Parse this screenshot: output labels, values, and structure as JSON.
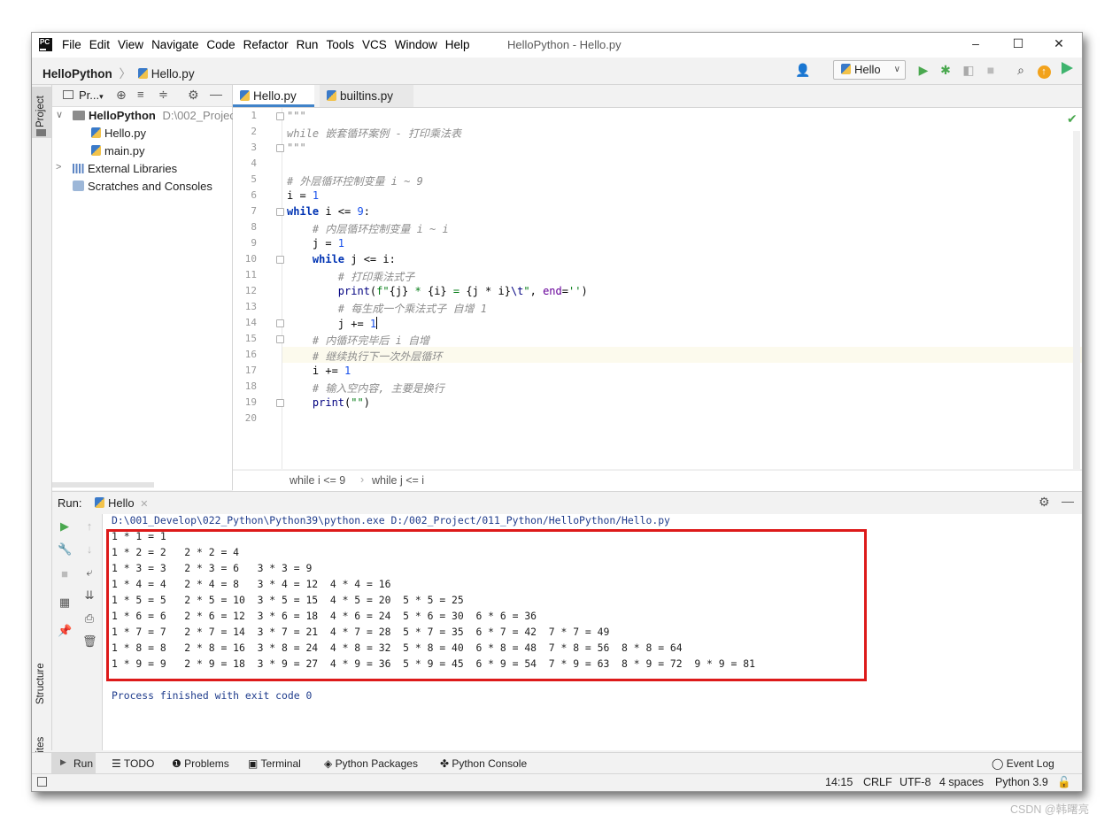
{
  "titlebar": {
    "menu": [
      "File",
      "Edit",
      "View",
      "Navigate",
      "Code",
      "Refactor",
      "Run",
      "Tools",
      "VCS",
      "Window",
      "Help"
    ],
    "title": "HelloPython - Hello.py",
    "controls": [
      "–",
      "☐",
      "✕"
    ]
  },
  "navbar": {
    "project": "HelloPython",
    "file": "Hello.py",
    "run_config": "Hello"
  },
  "left_stripe": {
    "project_tab": "Project",
    "structure_tab": "Structure",
    "favorites_tab": "Favorites"
  },
  "project_panel": {
    "header": "Pr...",
    "tree": [
      {
        "label": "HelloPython",
        "path": "D:\\002_Projec"
      },
      {
        "label": "Hello.py"
      },
      {
        "label": "main.py"
      },
      {
        "label": "External Libraries"
      },
      {
        "label": "Scratches and Consoles"
      }
    ]
  },
  "editor": {
    "tabs": [
      "Hello.py",
      "builtins.py"
    ],
    "breadcrumb": [
      "while i <= 9",
      "while j <= i"
    ],
    "current_line": 14,
    "line_count": 20
  },
  "run_panel": {
    "label": "Run:",
    "tab": "Hello",
    "command": "D:\\001_Develop\\022_Python\\Python39\\python.exe D:/002_Project/011_Python/HelloPython/Hello.py",
    "output": [
      "1 * 1 = 1",
      "1 * 2 = 2   2 * 2 = 4",
      "1 * 3 = 3   2 * 3 = 6   3 * 3 = 9",
      "1 * 4 = 4   2 * 4 = 8   3 * 4 = 12  4 * 4 = 16",
      "1 * 5 = 5   2 * 5 = 10  3 * 5 = 15  4 * 5 = 20  5 * 5 = 25",
      "1 * 6 = 6   2 * 6 = 12  3 * 6 = 18  4 * 6 = 24  5 * 6 = 30  6 * 6 = 36",
      "1 * 7 = 7   2 * 7 = 14  3 * 7 = 21  4 * 7 = 28  5 * 7 = 35  6 * 7 = 42  7 * 7 = 49",
      "1 * 8 = 8   2 * 8 = 16  3 * 8 = 24  4 * 8 = 32  5 * 8 = 40  6 * 8 = 48  7 * 8 = 56  8 * 8 = 64",
      "1 * 9 = 9   2 * 9 = 18  3 * 9 = 27  4 * 9 = 36  5 * 9 = 45  6 * 9 = 54  7 * 9 = 63  8 * 9 = 72  9 * 9 = 81"
    ],
    "exit_message": "Process finished with exit code 0"
  },
  "bottom_tabs": [
    "Run",
    "TODO",
    "Problems",
    "Terminal",
    "Python Packages",
    "Python Console",
    "Event Log"
  ],
  "status": {
    "position": "14:15",
    "line_sep": "CRLF",
    "encoding": "UTF-8",
    "indent": "4 spaces",
    "interpreter": "Python 3.9"
  },
  "watermark": "CSDN @韩曙亮",
  "colors": {
    "accent": "#4083c9",
    "highlight_box": "#dd1a1a",
    "run_green": "#4aa84f"
  }
}
